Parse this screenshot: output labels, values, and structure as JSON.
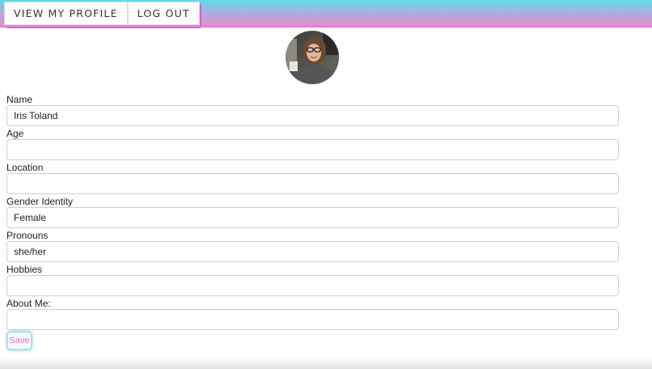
{
  "nav": {
    "view_profile_label": "VIEW MY PROFILE",
    "logout_label": "LOG OUT"
  },
  "fields": [
    {
      "label": "Name",
      "value": "Iris Toland"
    },
    {
      "label": "Age",
      "value": ""
    },
    {
      "label": "Location",
      "value": ""
    },
    {
      "label": "Gender Identity",
      "value": "Female"
    },
    {
      "label": "Pronouns",
      "value": "she/her"
    },
    {
      "label": "Hobbies",
      "value": ""
    },
    {
      "label": "About Me:",
      "value": ""
    }
  ],
  "save_label": "Save",
  "colors": {
    "topbar_cyan": "#5fdceb",
    "topbar_pink": "#e98dc7",
    "nav_shadow": "#d05fd0",
    "save_text": "#e76fb6",
    "save_border": "#a8e3ef"
  }
}
